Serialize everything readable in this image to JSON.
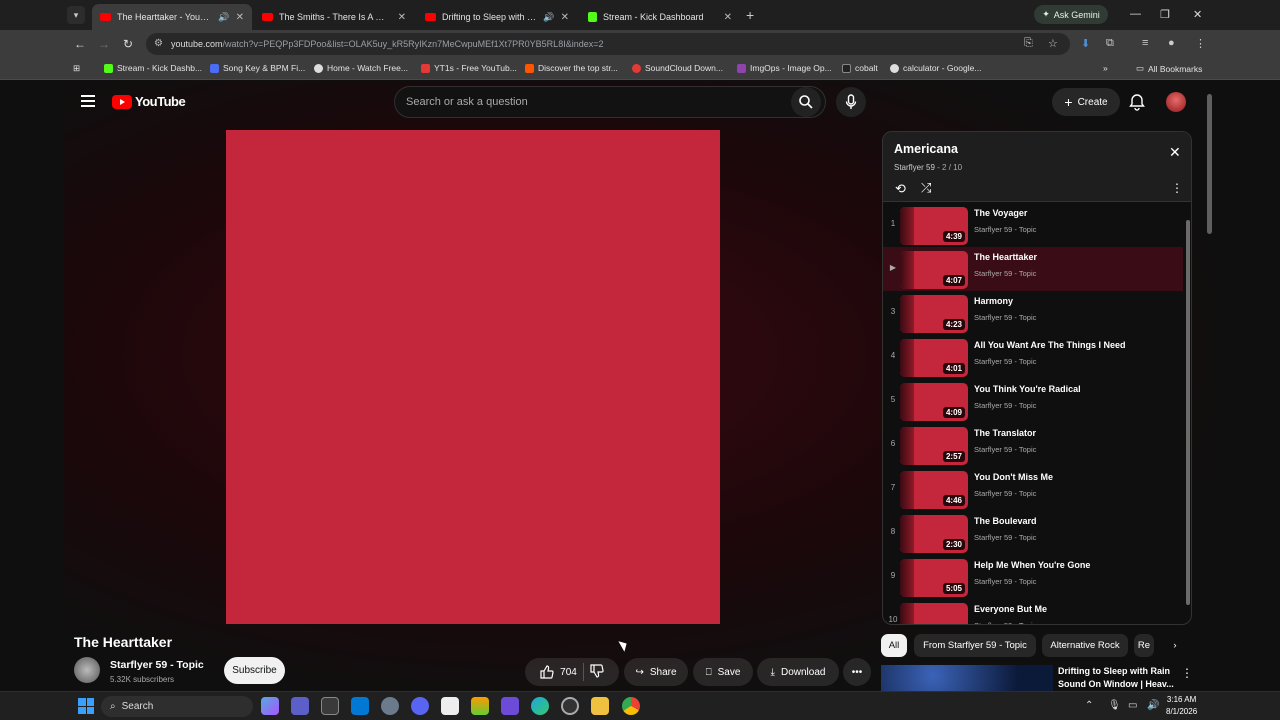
{
  "browser": {
    "tabs": [
      {
        "title": "The Hearttaker - YouTube",
        "favicon": "youtube-icon",
        "active": true,
        "audio": true
      },
      {
        "title": "The Smiths - There Is A Light Th",
        "favicon": "youtube-icon",
        "active": false,
        "audio": false
      },
      {
        "title": "Drifting to Sleep with Rain",
        "favicon": "youtube-icon",
        "active": false,
        "audio": true
      },
      {
        "title": "Stream - Kick Dashboard",
        "favicon": "kick-icon",
        "active": false,
        "audio": false
      }
    ],
    "ask_gemini": "Ask Gemini",
    "url_host": "youtube.com",
    "url_rest": "/watch?v=PEQPp3FDPoo&list=OLAK5uy_kR5RyIKzn7MeCwpuMEf1Xt7PR0YB5RL8I&index=2",
    "bookmarks": [
      {
        "label": "Stream - Kick Dashb...",
        "color": "#53fc18"
      },
      {
        "label": "Song Key & BPM Fi...",
        "color": "#4a6cf7"
      },
      {
        "label": "Home - Watch Free...",
        "color": "#dddddd"
      },
      {
        "label": "YT1s - Free YouTub...",
        "color": "#e53935"
      },
      {
        "label": "Discover the top str...",
        "color": "#ff5500"
      },
      {
        "label": "SoundCloud Down...",
        "color": "#e53935"
      },
      {
        "label": "ImgOps - Image Op...",
        "color": "#8e44ad"
      },
      {
        "label": "cobalt",
        "color": "#222222"
      },
      {
        "label": "calculator - Google...",
        "color": "#dddddd"
      }
    ],
    "all_bookmarks": "All Bookmarks"
  },
  "youtube": {
    "logo_text": "YouTube",
    "search_placeholder": "Search or ask a question",
    "create_label": "Create",
    "video_title": "The Hearttaker",
    "channel_name": "Starflyer 59 - Topic",
    "subscribers": "5.32K subscribers",
    "subscribe_label": "Subscribe",
    "like_count": "704",
    "share_label": "Share",
    "save_label": "Save",
    "download_label": "Download",
    "album_color": "#c4273b"
  },
  "playlist": {
    "title": "Americana",
    "channel": "Starflyer 59",
    "position": "2 / 10",
    "items": [
      {
        "index": "1",
        "title": "The Voyager",
        "artist": "Starflyer 59 - Topic",
        "duration": "4:39"
      },
      {
        "index": "▶",
        "title": "The Hearttaker",
        "artist": "Starflyer 59 - Topic",
        "duration": "4:07"
      },
      {
        "index": "3",
        "title": "Harmony",
        "artist": "Starflyer 59 - Topic",
        "duration": "4:23"
      },
      {
        "index": "4",
        "title": "All You Want Are The Things I Need",
        "artist": "Starflyer 59 - Topic",
        "duration": "4:01"
      },
      {
        "index": "5",
        "title": "You Think You're Radical",
        "artist": "Starflyer 59 - Topic",
        "duration": "4:09"
      },
      {
        "index": "6",
        "title": "The Translator",
        "artist": "Starflyer 59 - Topic",
        "duration": "2:57"
      },
      {
        "index": "7",
        "title": "You Don't Miss Me",
        "artist": "Starflyer 59 - Topic",
        "duration": "4:46"
      },
      {
        "index": "8",
        "title": "The Boulevard",
        "artist": "Starflyer 59 - Topic",
        "duration": "2:30"
      },
      {
        "index": "9",
        "title": "Help Me When You're Gone",
        "artist": "Starflyer 59 - Topic",
        "duration": "5:05"
      },
      {
        "index": "10",
        "title": "Everyone But Me",
        "artist": "Starflyer 59 - Topic",
        "duration": ""
      }
    ]
  },
  "chips": [
    "All",
    "From Starflyer 59 - Topic",
    "Alternative Rock",
    "Re"
  ],
  "recommendation": {
    "title": "Drifting to Sleep with Rain Sound On Window | Heav..."
  },
  "taskbar": {
    "search_label": "Search",
    "time": "3:16 AM",
    "date": "8/1/2026"
  }
}
